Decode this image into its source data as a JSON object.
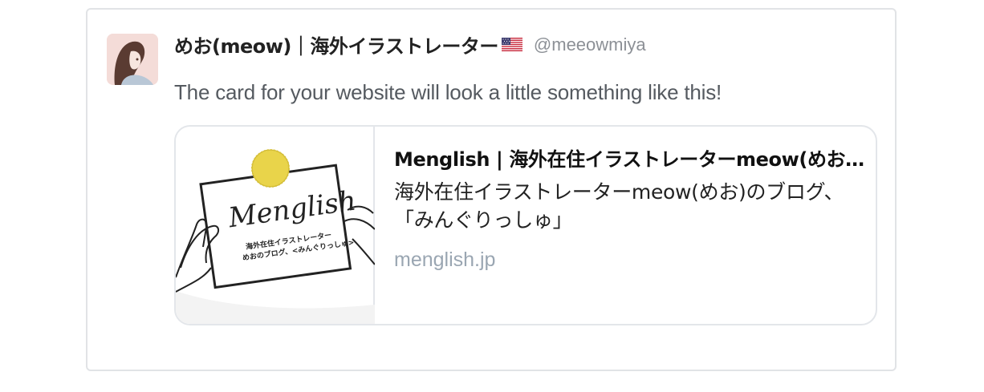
{
  "tweet": {
    "author": {
      "display_name": "めお(meow)｜海外イラストレーター",
      "handle": "@meeowmiya",
      "flag_icon": "us-flag-icon",
      "avatar_icon": "avatar-illustration-icon"
    },
    "text": "The card for your website will look a little something like this!",
    "card": {
      "title": "Menglish | 海外在住イラストレーターmeow(めお)のブログ",
      "description": "海外在住イラストレーターmeow(めお)のブログ、「みんぐりっしゅ」",
      "domain": "menglish.jp",
      "image": {
        "script_text": "Menglish",
        "caption_line1": "海外在住イラストレーター",
        "caption_line2": "めおのブログ、<みんぐりっしゅ>"
      }
    }
  },
  "colors": {
    "border": "#e1e3e6",
    "text_secondary": "#555a60",
    "handle": "#8c9096",
    "domain": "#9aa6b2",
    "sticker_yellow": "#e9d44a"
  }
}
